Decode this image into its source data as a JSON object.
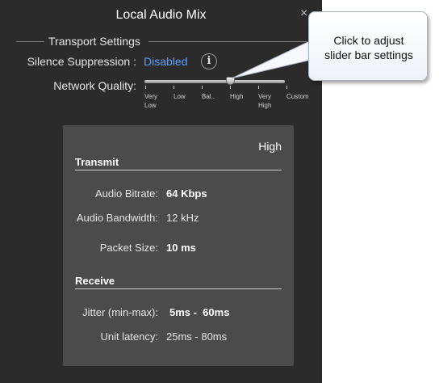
{
  "window": {
    "title": "Local Audio Mix",
    "close_glyph": "×"
  },
  "transport": {
    "section_title": "Transport Settings",
    "silence_label": "Silence Suppression :",
    "silence_value": "Disabled",
    "info_icon_glyph": "i",
    "network_label": "Network Quality:",
    "slider": {
      "levels": [
        "Very Low",
        "Low",
        "Bal..",
        "High",
        "Very High",
        "Custom"
      ],
      "selected": "High",
      "selected_index": 3
    }
  },
  "details": {
    "level": "High",
    "transmit": {
      "heading": "Transmit",
      "bitrate_label": "Audio Bitrate:",
      "bitrate_value": "64 Kbps",
      "bandwidth_label": "Audio Bandwidth:",
      "bandwidth_value": "12 kHz",
      "packet_label": "Packet Size:",
      "packet_value": "10 ms"
    },
    "receive": {
      "heading": "Receive",
      "jitter_label": "Jitter (min-max):",
      "jitter_value": "5ms -  60ms",
      "latency_label": "Unit latency:",
      "latency_value": "25ms - 80ms"
    }
  },
  "callout": {
    "line1": "Click to adjust",
    "line2": "slider bar settings"
  },
  "colors": {
    "panel": "#2b2b2b",
    "box": "#4b4b4b",
    "link": "#5aa0ff"
  }
}
